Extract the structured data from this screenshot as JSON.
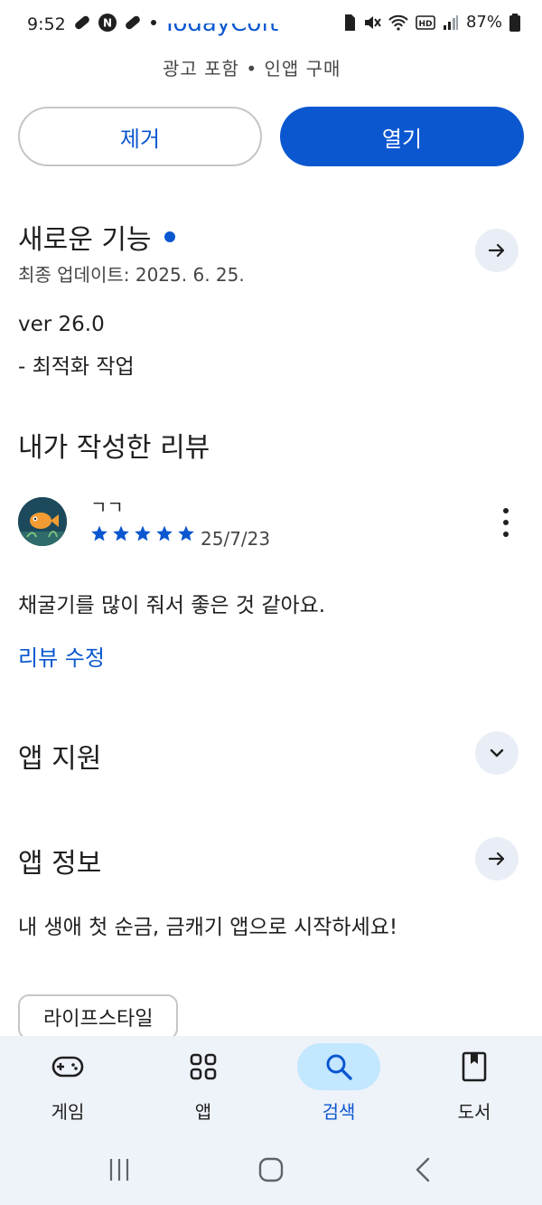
{
  "status_bar": {
    "time": "9:52",
    "battery": "87%",
    "left_icons": [
      "link-icon",
      "n-badge-icon",
      "link-icon",
      "dot-icon"
    ],
    "right_icons": [
      "sim-icon",
      "mute-icon",
      "wifi-icon",
      "hd-icon",
      "signal-icon",
      "battery-icon"
    ]
  },
  "app_header": {
    "developer_partial": "TodayCoft",
    "meta": "광고 포함 • 인앱 구매"
  },
  "actions": {
    "remove_label": "제거",
    "open_label": "열기"
  },
  "whats_new": {
    "title": "새로운 기능",
    "updated": "최종 업데이트: 2025. 6. 25.",
    "version": "ver 26.0",
    "note": "- 최적화 작업"
  },
  "my_review": {
    "section_title": "내가 작성한 리뷰",
    "author": "ㄱㄱ",
    "rating": 5,
    "date": "25/7/23",
    "text": "채굴기를 많이 줘서 좋은 것 같아요.",
    "edit_label": "리뷰 수정"
  },
  "app_support": {
    "title": "앱 지원"
  },
  "app_info": {
    "title": "앱 정보",
    "description": "내 생애 첫 순금, 금캐기 앱으로 시작하세요!",
    "category_chip": "라이프스타일"
  },
  "bottom_nav": {
    "items": [
      {
        "label": "게임",
        "icon": "gamepad-icon",
        "active": false
      },
      {
        "label": "앱",
        "icon": "apps-grid-icon",
        "active": false
      },
      {
        "label": "검색",
        "icon": "search-icon",
        "active": true
      },
      {
        "label": "도서",
        "icon": "book-icon",
        "active": false
      }
    ]
  },
  "colors": {
    "accent": "#0b57d0",
    "active_pill": "#c2e7ff",
    "nav_bg": "#eef2f9"
  }
}
